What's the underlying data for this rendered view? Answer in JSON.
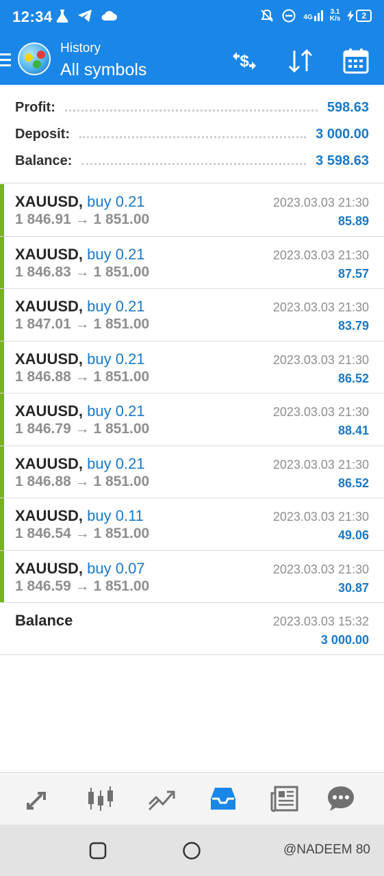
{
  "status_bar": {
    "time": "12:34",
    "network_speed_top": "3.1",
    "network_speed_bottom": "K/s",
    "signal_label": "4G",
    "battery": "2"
  },
  "header": {
    "subtitle": "History",
    "title": "All symbols",
    "icons": [
      "currency-exchange-icon",
      "sort-icon",
      "calendar-icon"
    ]
  },
  "summary": {
    "profit_label": "Profit:",
    "profit_value": "598.63",
    "deposit_label": "Deposit:",
    "deposit_value": "3 000.00",
    "balance_label": "Balance:",
    "balance_value": "3 598.63"
  },
  "trades": [
    {
      "symbol": "XAUUSD,",
      "direction": "buy 0.21",
      "open_price": "1 846.91",
      "arrow": "→",
      "close_price": "1 851.00",
      "datetime": "2023.03.03 21:30",
      "profit": "85.89"
    },
    {
      "symbol": "XAUUSD,",
      "direction": "buy 0.21",
      "open_price": "1 846.83",
      "arrow": "→",
      "close_price": "1 851.00",
      "datetime": "2023.03.03 21:30",
      "profit": "87.57"
    },
    {
      "symbol": "XAUUSD,",
      "direction": "buy 0.21",
      "open_price": "1 847.01",
      "arrow": "→",
      "close_price": "1 851.00",
      "datetime": "2023.03.03 21:30",
      "profit": "83.79"
    },
    {
      "symbol": "XAUUSD,",
      "direction": "buy 0.21",
      "open_price": "1 846.88",
      "arrow": "→",
      "close_price": "1 851.00",
      "datetime": "2023.03.03 21:30",
      "profit": "86.52"
    },
    {
      "symbol": "XAUUSD,",
      "direction": "buy 0.21",
      "open_price": "1 846.79",
      "arrow": "→",
      "close_price": "1 851.00",
      "datetime": "2023.03.03 21:30",
      "profit": "88.41"
    },
    {
      "symbol": "XAUUSD,",
      "direction": "buy 0.21",
      "open_price": "1 846.88",
      "arrow": "→",
      "close_price": "1 851.00",
      "datetime": "2023.03.03 21:30",
      "profit": "86.52"
    },
    {
      "symbol": "XAUUSD,",
      "direction": "buy 0.11",
      "open_price": "1 846.54",
      "arrow": "→",
      "close_price": "1 851.00",
      "datetime": "2023.03.03 21:30",
      "profit": "49.06"
    },
    {
      "symbol": "XAUUSD,",
      "direction": "buy 0.07",
      "open_price": "1 846.59",
      "arrow": "→",
      "close_price": "1 851.00",
      "datetime": "2023.03.03 21:30",
      "profit": "30.87"
    }
  ],
  "balance_entry": {
    "label": "Balance",
    "datetime": "2023.03.03 15:32",
    "amount": "3 000.00"
  },
  "bottom_nav": {
    "tabs": [
      "quotes-icon",
      "chart-icon",
      "trade-icon",
      "history-icon",
      "news-icon",
      "chat-icon"
    ],
    "active": "history-icon"
  },
  "watermark": "@NADEEM 80",
  "colors": {
    "header_blue": "#1a86e8",
    "value_blue": "#1a78c8",
    "buy_bar_green": "#77b41c",
    "muted_gray": "#8e8e8e"
  }
}
